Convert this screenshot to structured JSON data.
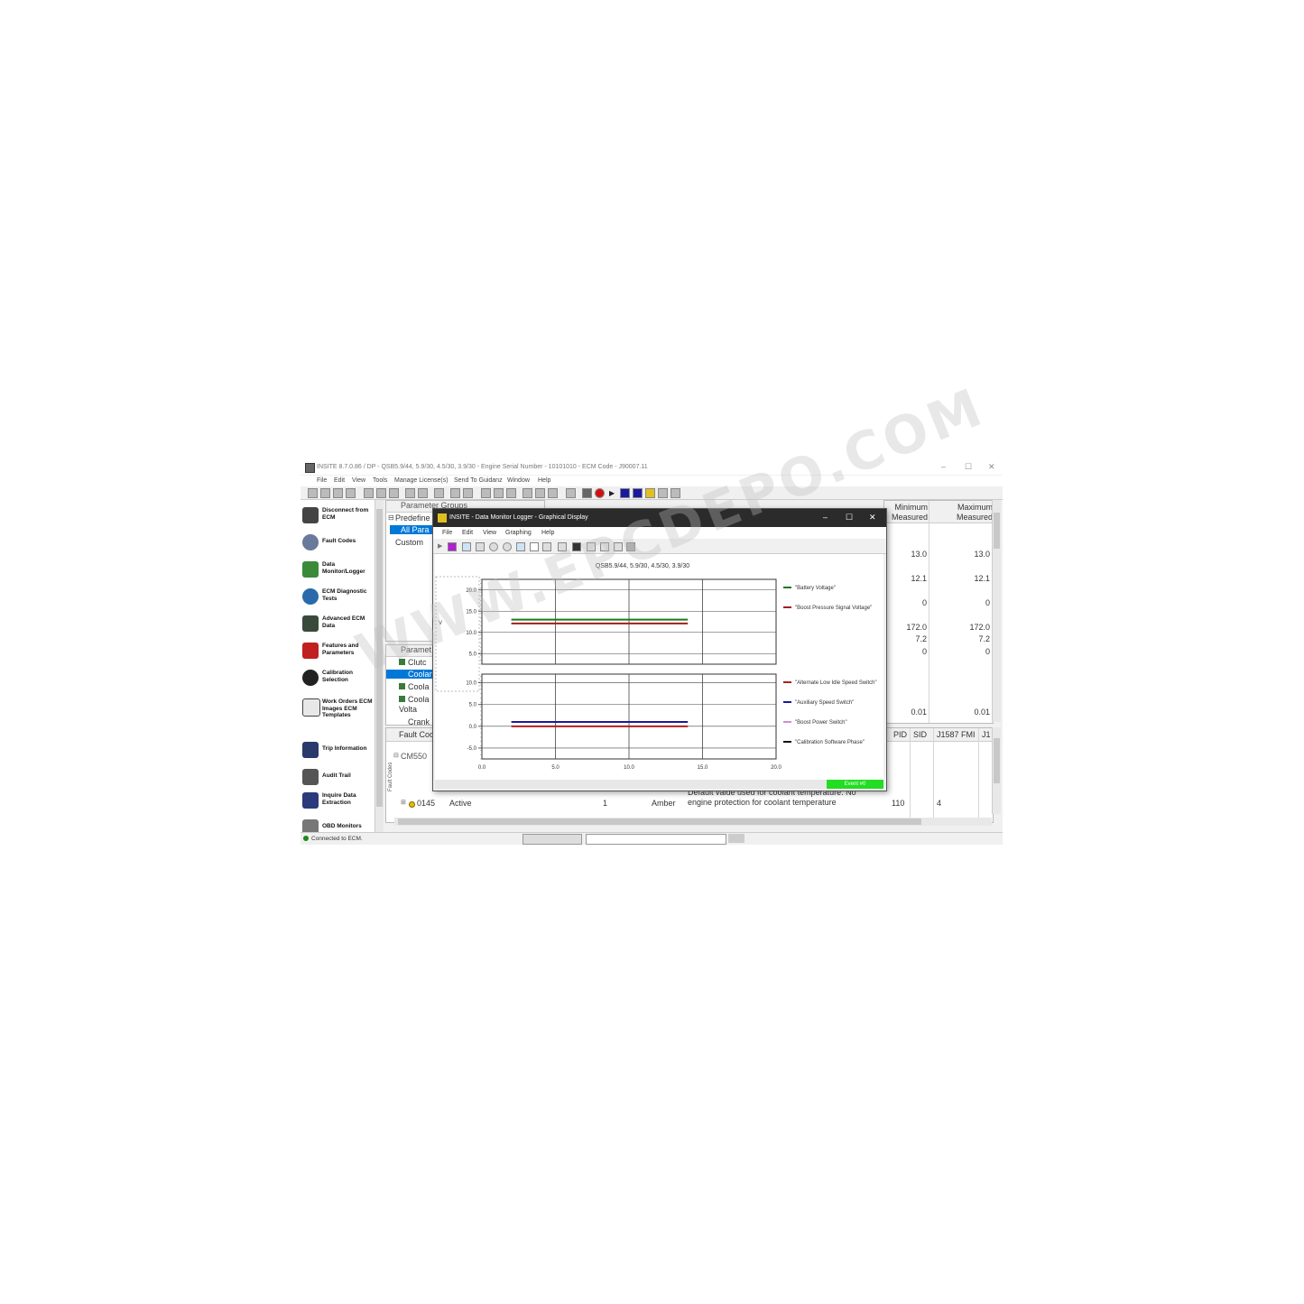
{
  "app": {
    "title": "INSITE 8.7.0.86 / DP - QSB5.9/44, 5.9/30, 4.5/30, 3.9/30 - Engine Serial Number - 10101010 - ECM Code - J90007.11",
    "menu": [
      "File",
      "Edit",
      "View",
      "Tools",
      "Manage License(s)",
      "Send To Guidanz",
      "Window",
      "Help"
    ],
    "window_controls": {
      "minimize": "–",
      "maximize": "☐",
      "close": "✕"
    }
  },
  "nav": {
    "items": [
      {
        "label": "Disconnect from ECM",
        "icon": "disconnect-icon"
      },
      {
        "label": "Fault Codes",
        "icon": "fault-codes-icon"
      },
      {
        "label": "Data Monitor/Logger",
        "icon": "data-monitor-icon"
      },
      {
        "label": "ECM Diagnostic Tests",
        "icon": "diagnostic-icon"
      },
      {
        "label": "Advanced ECM Data",
        "icon": "advanced-data-icon"
      },
      {
        "label": "Features and Parameters",
        "icon": "features-icon"
      },
      {
        "label": "Calibration Selection",
        "icon": "calibration-icon"
      },
      {
        "label": "Work Orders ECM Images ECM Templates",
        "icon": "work-orders-icon"
      },
      {
        "label": "Trip Information",
        "icon": "trip-icon"
      },
      {
        "label": "Audit Trail",
        "icon": "audit-icon"
      },
      {
        "label": "Inquire Data Extraction",
        "icon": "inquire-icon"
      },
      {
        "label": "OBD Monitors",
        "icon": "obd-icon"
      }
    ]
  },
  "param_groups": {
    "header": "Parameter Groups",
    "items": [
      "Predefine",
      "All Para",
      "Custom"
    ]
  },
  "param_list": {
    "header": "Paramet",
    "items": [
      "Clutc",
      "Coolant",
      "Coola",
      "Coola Volta",
      "Crank"
    ]
  },
  "measured": {
    "min_header": "Minimum Measured",
    "max_header": "Maximum Measured",
    "min_values": [
      "13.0",
      "12.1",
      "0",
      "172.0",
      "7.2",
      "0",
      "0.01"
    ],
    "max_values": [
      "13.0",
      "12.1",
      "0",
      "172.0",
      "7.2",
      "0",
      "0.01"
    ]
  },
  "fault_table": {
    "side_label": "Fault Codes",
    "header_left": "Fault Coo",
    "group_label": "CM550",
    "columns": [
      "PID",
      "SID",
      "J1587 FMI",
      "J1"
    ],
    "row": {
      "code": "0145",
      "status": "Active",
      "count": "1",
      "lamp": "Amber",
      "description": "Default value used for coolant temperature. No engine protection for coolant temperature",
      "pid": "110",
      "fmi": "4"
    }
  },
  "status": {
    "connection": "Connected to ECM."
  },
  "graph_window": {
    "title": "INSITE - Data Monitor Logger - Graphical Display",
    "menu": [
      "File",
      "Edit",
      "View",
      "Graphing",
      "Help"
    ],
    "event_label": "Event #0",
    "event_color": "#22dd22"
  },
  "chart_data": [
    {
      "type": "line",
      "title": "QSB5.9/44, 5.9/30, 4.5/30, 3.9/30",
      "ylabel": "V",
      "xlim": [
        0,
        20
      ],
      "ylim": [
        2.5,
        22.5
      ],
      "yticks": [
        "20.0",
        "15.0",
        "10.0",
        "5.0"
      ],
      "grid": true,
      "legend_position": "right",
      "series": [
        {
          "name": "\"Battery Voltage\"",
          "color": "#1a7a1a",
          "x": [
            2,
            14
          ],
          "y": [
            13.0,
            13.0
          ]
        },
        {
          "name": "\"Boost Pressure Signal Voltage\"",
          "color": "#a02020",
          "x": [
            2,
            14
          ],
          "y": [
            12.1,
            12.1
          ]
        }
      ]
    },
    {
      "type": "line",
      "xlim": [
        0,
        20
      ],
      "ylim": [
        -7.5,
        12.0
      ],
      "yticks": [
        "10.0",
        "5.0",
        "0.0",
        "-5.0"
      ],
      "xticks": [
        "0.0",
        "5.0",
        "10.0",
        "15.0",
        "20.0"
      ],
      "grid": true,
      "legend_position": "right",
      "series": [
        {
          "name": "\"Alternate Low Idle Speed Switch\"",
          "color": "#b02020",
          "x": [
            2,
            14
          ],
          "y": [
            0.0,
            0.0
          ]
        },
        {
          "name": "\"Auxiliary Speed Switch\"",
          "color": "#1a1a9a",
          "x": [
            2,
            14
          ],
          "y": [
            1.0,
            1.0
          ]
        },
        {
          "name": "\"Boost Power Switch\"",
          "color": "#d090d0",
          "x": [
            2,
            14
          ],
          "y": [
            null,
            null
          ]
        },
        {
          "name": "\"Calibration Software Phase\"",
          "color": "#111111",
          "x": [
            2,
            14
          ],
          "y": [
            null,
            null
          ]
        }
      ]
    }
  ],
  "watermark": "WWW.EPCDEPO.COM"
}
